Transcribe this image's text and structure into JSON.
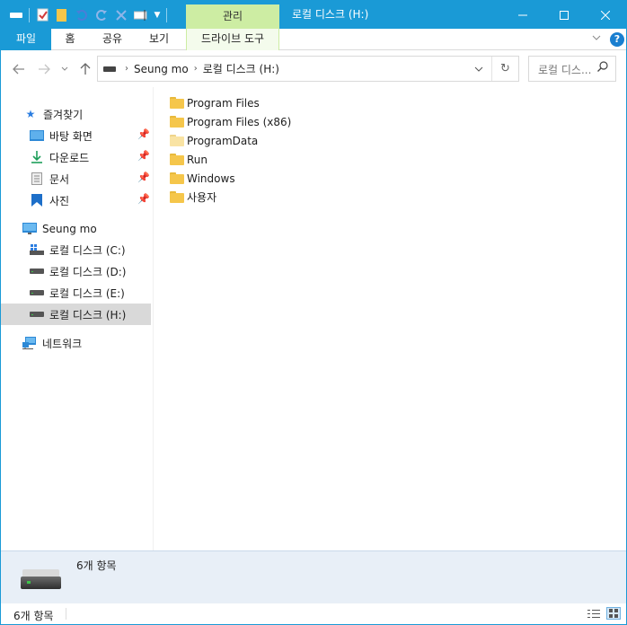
{
  "title_bar": {
    "context_tab_label": "관리",
    "window_title": "로컬 디스크 (H:)"
  },
  "ribbon": {
    "tabs": [
      "파일",
      "홈",
      "공유",
      "보기",
      "드라이브 도구"
    ]
  },
  "address_bar": {
    "crumbs": [
      "Seung mo",
      "로컬 디스크 (H:)"
    ]
  },
  "search": {
    "placeholder": "로컬 디스..."
  },
  "nav_pane": {
    "quick_access": "즐겨찾기",
    "pinned": [
      "바탕 화면",
      "다운로드",
      "문서",
      "사진"
    ],
    "this_pc": "Seung mo",
    "drives": [
      "로컬 디스크 (C:)",
      "로컬 디스크 (D:)",
      "로컬 디스크 (E:)",
      "로컬 디스크 (H:)"
    ],
    "network": "네트워크",
    "selected": "로컬 디스크 (H:)"
  },
  "files": [
    {
      "name": "Program Files"
    },
    {
      "name": "Program Files (x86)"
    },
    {
      "name": "ProgramData",
      "hidden": true
    },
    {
      "name": "Run"
    },
    {
      "name": "Windows"
    },
    {
      "name": "사용자"
    }
  ],
  "details_pane": {
    "summary": "6개 항목"
  },
  "status_bar": {
    "item_count": "6개 항목"
  },
  "colors": {
    "accent": "#1a9ad6",
    "context_tab": "#cdeda3",
    "selection": "#d9d9d9"
  }
}
